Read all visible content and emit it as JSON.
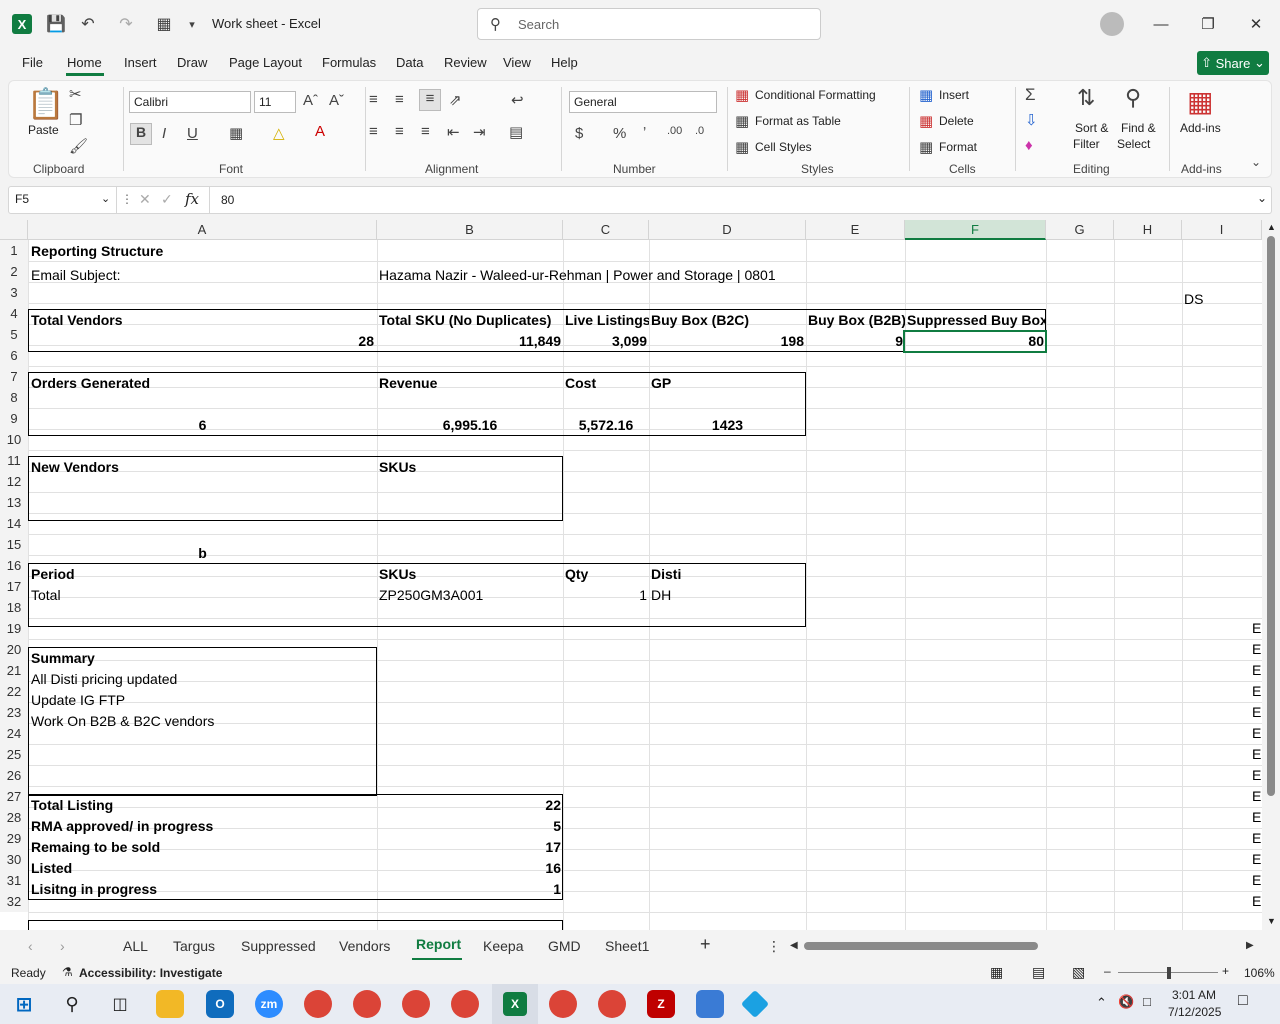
{
  "titlebar": {
    "title": "Work sheet  -  Excel",
    "search_placeholder": "Search"
  },
  "menu": [
    "File",
    "Home",
    "Insert",
    "Draw",
    "Page Layout",
    "Formulas",
    "Data",
    "Review",
    "View",
    "Help"
  ],
  "share_label": "Share",
  "ribbon": {
    "paste": "Paste",
    "clipboard": "Clipboard",
    "font_name": "Calibri",
    "font_size": "11",
    "font": "Font",
    "alignment": "Alignment",
    "number_format": "General",
    "number": "Number",
    "cond_format": "Conditional Formatting",
    "format_table": "Format as Table",
    "cell_styles": "Cell Styles",
    "styles": "Styles",
    "insert": "Insert",
    "delete": "Delete",
    "format": "Format",
    "cells": "Cells",
    "sort1": "Sort &",
    "sort2": "Filter",
    "find1": "Find &",
    "find2": "Select",
    "editing": "Editing",
    "addins": "Add-ins",
    "addins_grp": "Add-ins"
  },
  "formula": {
    "name_box": "F5",
    "value": "80"
  },
  "columns": [
    "A",
    "B",
    "C",
    "D",
    "E",
    "F",
    "G",
    "H",
    "I"
  ],
  "rows": [
    "1",
    "2",
    "3",
    "4",
    "5",
    "6",
    "7",
    "8",
    "9",
    "10",
    "11",
    "12",
    "13",
    "14",
    "15",
    "16",
    "17",
    "18",
    "19",
    "20",
    "21",
    "22",
    "23",
    "24",
    "25",
    "26",
    "27",
    "28",
    "29",
    "30",
    "31",
    "32"
  ],
  "cells": {
    "a1": "Reporting Structure",
    "a2": "Email Subject:",
    "b2": "Hazama Nazir - Waleed-ur-Rehman | Power and Storage | 0801",
    "i3": "DS",
    "a4": "Total Vendors",
    "b4": "Total SKU (No Duplicates)",
    "c4": "Live Listings",
    "d4": "Buy Box (B2C)",
    "e4": "Buy Box (B2B)",
    "f4": "Suppressed Buy Box",
    "a5": "28",
    "b5": "11,849",
    "c5": "3,099",
    "d5": "198",
    "e5": "9",
    "f5": "80",
    "a7": "Orders Generated",
    "b7": "Revenue",
    "c7": "Cost",
    "d7": "GP",
    "a9": "6",
    "b9": "6,995.16",
    "c9": "5,572.16",
    "d9": "1423",
    "a11": "New Vendors",
    "b11": "SKUs",
    "a15": "b",
    "a16": "Period",
    "b16": "SKUs",
    "c16": "Qty",
    "d16": "Disti",
    "a17": "Total",
    "b17": "ZP250GM3A001",
    "c17": "1",
    "d17": "DH",
    "a20": "Summary",
    "a21": "All Disti pricing updated",
    "a22": "Update IG FTP",
    "a23": "Work On B2B & B2C vendors",
    "a27": "Total Listing",
    "b27": "22",
    "a28": "RMA approved/ in progress",
    "b28": "5",
    "a29": "Remaing to be sold",
    "b29": "17",
    "a30": "Listed",
    "b30": "16",
    "a31": "Lisitng in progress",
    "b31": "1",
    "col_i_edge": "E"
  },
  "tabs": [
    "ALL",
    "Targus",
    "Suppressed",
    "Vendors",
    "Report",
    "Keepa",
    "GMD",
    "Sheet1"
  ],
  "status": {
    "ready": "Ready",
    "accessibility": "Accessibility: Investigate",
    "zoom": "106%"
  },
  "clock": {
    "time": "3:01 AM",
    "date": "7/12/2025"
  }
}
